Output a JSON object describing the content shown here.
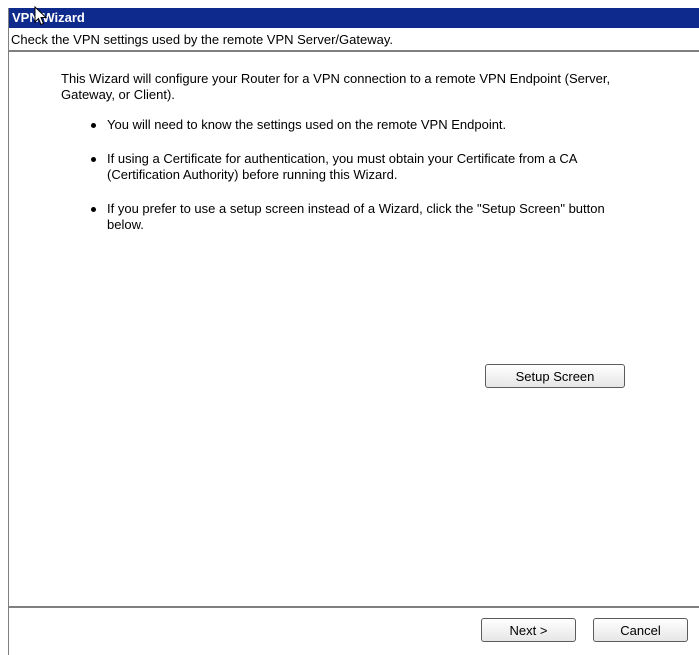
{
  "window": {
    "title": "VPN Wizard",
    "subtitle": "Check the VPN settings used by the remote VPN Server/Gateway."
  },
  "content": {
    "intro": "This Wizard will configure your Router for a VPN connection to a remote VPN Endpoint (Server, Gateway, or Client).",
    "bullets": [
      "You will need to know the settings used on the remote VPN Endpoint.",
      "If using a Certificate for authentication, you must obtain your Certificate from a CA (Certification Authority) before running this Wizard.",
      "If you prefer to use a setup screen instead of a Wizard, click the \"Setup Screen\" button below."
    ],
    "setup_button": "Setup Screen"
  },
  "footer": {
    "next_button": "Next >",
    "cancel_button": "Cancel"
  },
  "colors": {
    "titlebar": "#0e2a8c",
    "title_text": "#ffffff"
  },
  "icons": {
    "cursor": "mouse-pointer-icon"
  }
}
